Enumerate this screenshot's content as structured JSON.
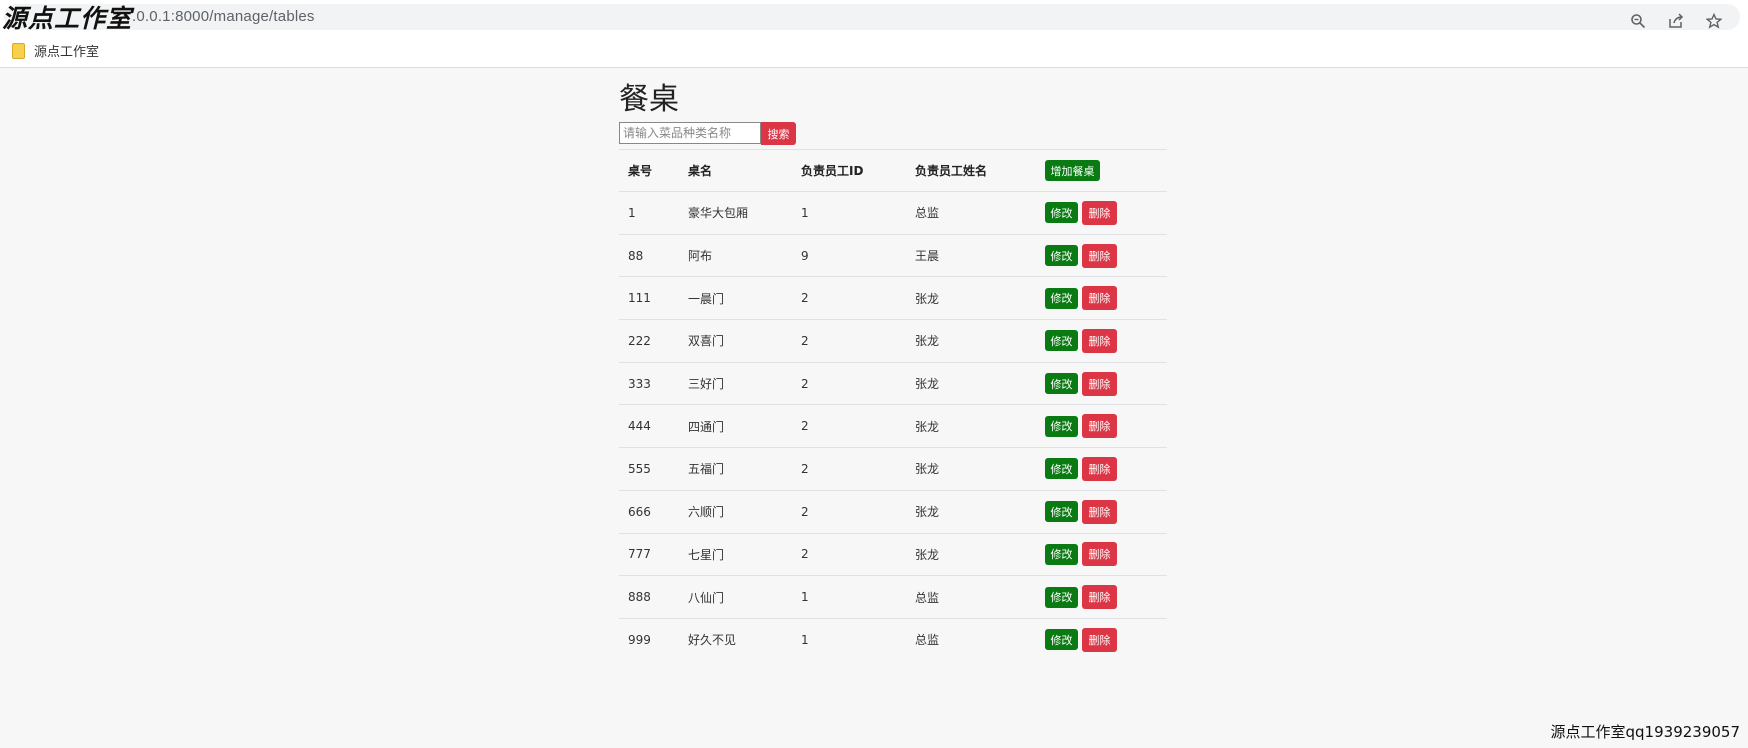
{
  "browser": {
    "url": ".0.0.1:8000/manage/tables",
    "watermark": "源点工作室",
    "bookmark_label": "源点工作室"
  },
  "page": {
    "title": "餐桌",
    "search_placeholder": "请输入菜品种类名称",
    "search_button": "搜索",
    "add_button": "增加餐桌",
    "edit_button": "修改",
    "delete_button": "删除"
  },
  "table": {
    "headers": [
      "桌号",
      "桌名",
      "负责员工ID",
      "负责员工姓名"
    ],
    "rows": [
      {
        "id": "1",
        "name": "豪华大包厢",
        "staff_id": "1",
        "staff_name": "总监"
      },
      {
        "id": "88",
        "name": "阿布",
        "staff_id": "9",
        "staff_name": "王晨"
      },
      {
        "id": "111",
        "name": "一晨门",
        "staff_id": "2",
        "staff_name": "张龙"
      },
      {
        "id": "222",
        "name": "双喜门",
        "staff_id": "2",
        "staff_name": "张龙"
      },
      {
        "id": "333",
        "name": "三好门",
        "staff_id": "2",
        "staff_name": "张龙"
      },
      {
        "id": "444",
        "name": "四通门",
        "staff_id": "2",
        "staff_name": "张龙"
      },
      {
        "id": "555",
        "name": "五福门",
        "staff_id": "2",
        "staff_name": "张龙"
      },
      {
        "id": "666",
        "name": "六顺门",
        "staff_id": "2",
        "staff_name": "张龙"
      },
      {
        "id": "777",
        "name": "七星门",
        "staff_id": "2",
        "staff_name": "张龙"
      },
      {
        "id": "888",
        "name": "八仙门",
        "staff_id": "1",
        "staff_name": "总监"
      },
      {
        "id": "999",
        "name": "好久不见",
        "staff_id": "1",
        "staff_name": "总监"
      }
    ]
  },
  "footer": {
    "watermark": "源点工作室qq1939239057"
  },
  "colors": {
    "accent_green": "#0a7a12",
    "accent_red": "#dc3545"
  }
}
